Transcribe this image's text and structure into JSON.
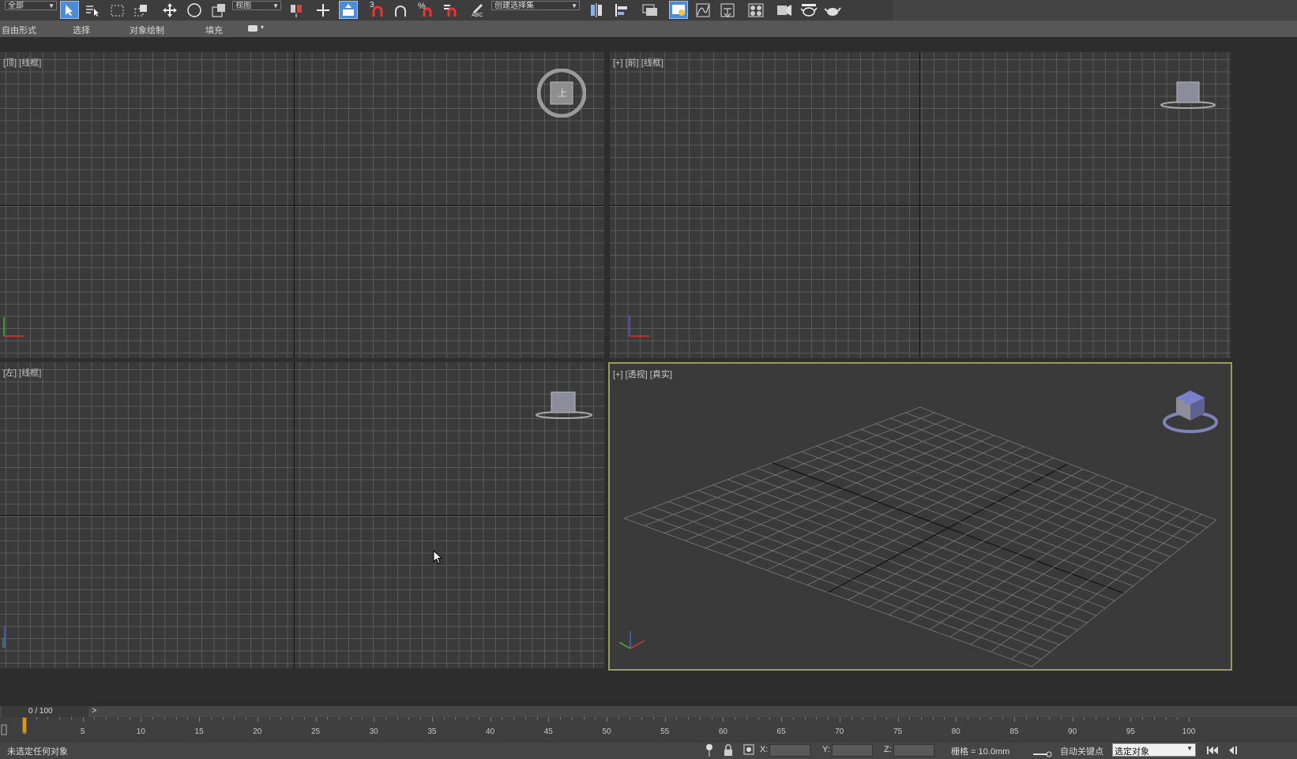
{
  "toolbar": {
    "filter_dropdown": "全部",
    "ref_coord_dropdown": "视图",
    "named_sel_dropdown": "创建选择集",
    "snap_labels": [
      "3",
      "2.5",
      "%",
      "ABC"
    ]
  },
  "ribbon": {
    "tabs": [
      "自由形式",
      "选择",
      "对象绘制",
      "填充"
    ]
  },
  "viewports": {
    "top": {
      "label": "[顶] [线框]",
      "viewcube_face": "上"
    },
    "front": {
      "label": "[+] [前] [线框]"
    },
    "left": {
      "label": "[左] [线框]"
    },
    "perspective": {
      "label": "[+] [透视] [真实]"
    }
  },
  "timebar": {
    "frame_display": "0 / 100",
    "next_arrow": ">"
  },
  "timeline": {
    "ticks": [
      "0",
      "5",
      "10",
      "15",
      "20",
      "25",
      "30",
      "35",
      "40",
      "45",
      "50",
      "55",
      "60",
      "65",
      "70",
      "75",
      "80",
      "85",
      "90",
      "95",
      "100"
    ]
  },
  "statusbar": {
    "message": "未选定任何对象",
    "x_label": "X:",
    "y_label": "Y:",
    "z_label": "Z:",
    "grid_text": "栅格 = 10.0mm",
    "autokey_label": "自动关键点",
    "selected_dropdown": "选定对象"
  },
  "colors": {
    "accent_blue": "#4d8bd6",
    "viewport_bg": "#3a3a3a",
    "grid_line": "#5a5a5a",
    "active_border": "#9b9b5a",
    "time_slider": "#d79a2a"
  }
}
